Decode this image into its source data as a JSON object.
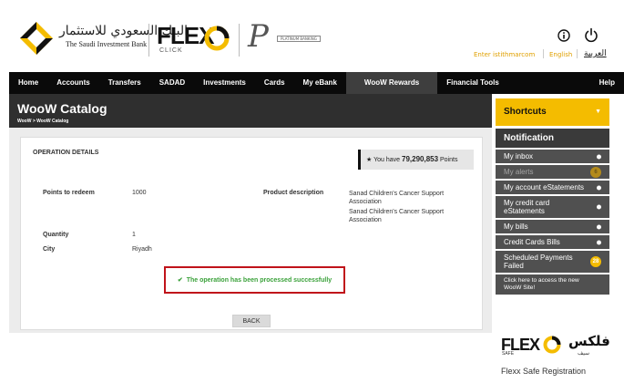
{
  "header": {
    "bank_name_ar": "البنك السعودي للاستثمار",
    "bank_name_en": "The Saudi Investment Bank",
    "flex_brand": "FLEX",
    "flex_sub": "CLICK",
    "platinum_mark": "P",
    "platinum_text": "PLATINUM BANKING",
    "user_link": "Enter istithmarcom",
    "lang_en": "English",
    "lang_ar": "العربية",
    "info_icon": "info-icon",
    "power_icon": "power-icon"
  },
  "nav": {
    "items": [
      "Home",
      "Accounts",
      "Transfers",
      "SADAD",
      "Investments",
      "Cards",
      "My eBank",
      "WooW Rewards",
      "Financial Tools",
      "Help"
    ],
    "active_index": 7
  },
  "title": {
    "heading": "WooW Catalog",
    "breadcrumb": "WooW > WooW Catalog"
  },
  "operation": {
    "section_title": "OPERATION DETAILS",
    "points_prefix": "You have",
    "points_value": "79,290,853",
    "points_suffix": "Points",
    "points_to_redeem_label": "Points to redeem",
    "points_to_redeem_value": "1000",
    "product_desc_label": "Product description",
    "product_desc_line1": "Sanad Children's Cancer Support Association",
    "product_desc_line2": "Sanad Children's Cancer Support Association",
    "quantity_label": "Quantity",
    "quantity_value": "1",
    "city_label": "City",
    "city_value": "Riyadh",
    "success_message": "The operation has been processed successfully",
    "back_label": "BACK"
  },
  "shortcuts": {
    "title": "Shortcuts",
    "notification_title": "Notification",
    "items": [
      {
        "label": "My inbox",
        "badge": ""
      },
      {
        "label": "My alerts",
        "badge": "6"
      },
      {
        "label": "My account eStatements",
        "badge": ""
      },
      {
        "label": "My credit card eStatements",
        "badge": ""
      },
      {
        "label": "My bills",
        "badge": ""
      },
      {
        "label": "Credit Cards Bills",
        "badge": ""
      },
      {
        "label": "Scheduled Payments Failed",
        "badge": "28"
      },
      {
        "label": "Click here to access the new WooW Site!",
        "badge": ""
      }
    ]
  },
  "flexx_safe": {
    "brand": "FLEX",
    "sub": "SAFE",
    "brand_ar": "فلكس",
    "sub_ar": "سيف",
    "registration": "Flexx Safe Registration"
  },
  "colors": {
    "accent": "#f4bc00",
    "nav_bg": "#0a0a0a",
    "title_bg": "#2f2f2f",
    "success": "#3aa13a",
    "highlight_border": "#c0131a"
  }
}
